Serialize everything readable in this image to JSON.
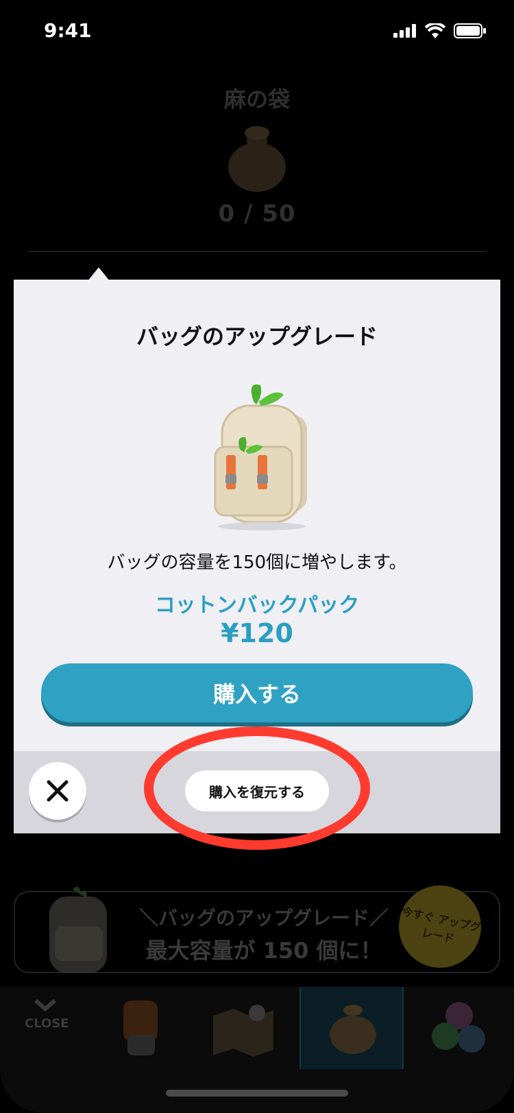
{
  "status_bar": {
    "time": "9:41"
  },
  "background": {
    "bag_title": "麻の袋",
    "bag_count": "0 / 50",
    "promo": {
      "line1": "＼バッグのアップグレード／",
      "line2": "最大容量が 150 個に！",
      "badge": "今すぐ アップグレード"
    },
    "tabbar": {
      "close_label": "CLOSE"
    }
  },
  "modal": {
    "title": "バッグのアップグレード",
    "description": "バッグの容量を150個に増やします。",
    "product_name": "コットンバックパック",
    "price": "¥120",
    "buy_label": "購入する",
    "restore_label": "購入を復元する"
  },
  "colors": {
    "accent": "#2fa2c3",
    "highlight": "#ff3a2f",
    "modal_bg": "#efeff4"
  }
}
